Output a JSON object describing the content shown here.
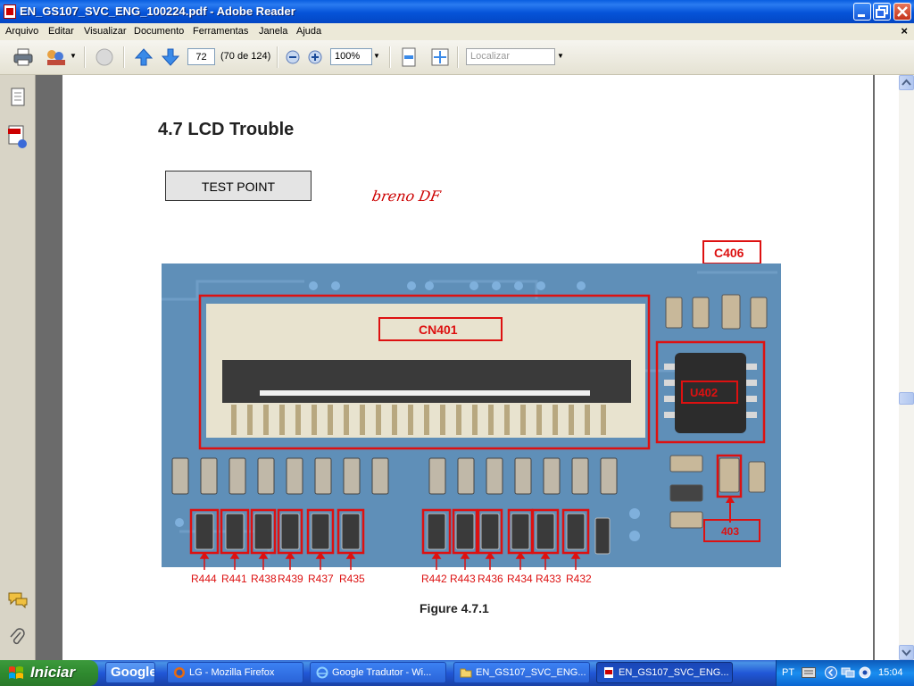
{
  "window": {
    "title": "EN_GS107_SVC_ENG_100224.pdf - Adobe Reader"
  },
  "menu": {
    "items": [
      "Arquivo",
      "Editar",
      "Visualizar",
      "Documento",
      "Ferramentas",
      "Janela",
      "Ajuda"
    ]
  },
  "toolbar": {
    "page_number": "72",
    "page_count": "(70 de 124)",
    "zoom": "100%",
    "search_placeholder": "Localizar"
  },
  "document": {
    "heading": "4.7 LCD Trouble",
    "test_point_label": "TEST POINT",
    "signature": "breno DF",
    "component_labels": {
      "cn401": "CN401",
      "c406": "C406",
      "u402": "U402",
      "c403": "403"
    },
    "resistor_labels": [
      "R444",
      "R441",
      "R438",
      "R439",
      "R437",
      "R435",
      "R442",
      "R443",
      "R436",
      "R434",
      "R433",
      "R432"
    ],
    "figure_caption": "Figure 4.7.1"
  },
  "taskbar": {
    "start_label": "Iniciar",
    "google_label": "Google",
    "tasks": [
      {
        "label": "LG - Mozilla Firefox"
      },
      {
        "label": "Google Tradutor - Wi..."
      },
      {
        "label": "EN_GS107_SVC_ENG..."
      },
      {
        "label": "EN_GS107_SVC_ENG..."
      }
    ],
    "language": "PT",
    "clock": "15:04"
  },
  "colors": {
    "titlebar": "#0553d8",
    "highlight_red": "#dd1111",
    "board_blue": "#5f8fb8"
  }
}
